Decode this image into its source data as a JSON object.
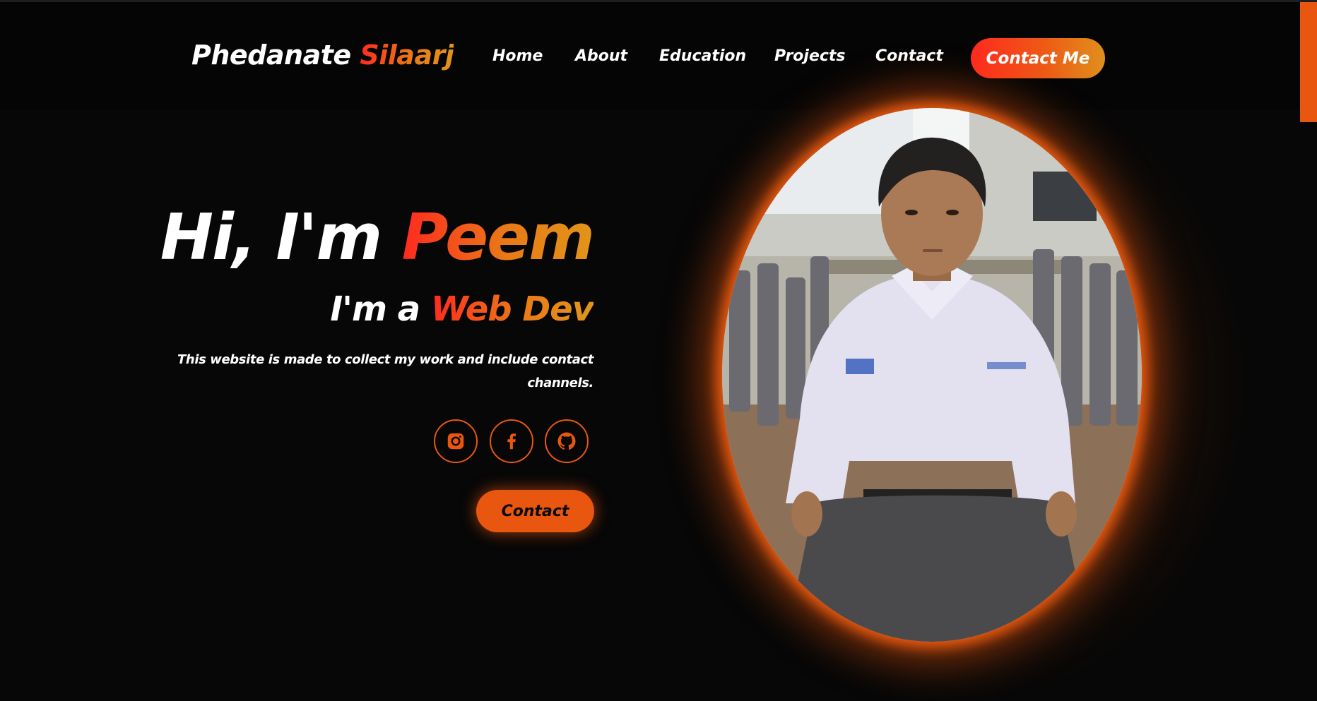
{
  "brand": {
    "first": "Phedanate",
    "last": "Silaarj"
  },
  "nav": {
    "items": [
      "Home",
      "About",
      "Education",
      "Projects",
      "Contact"
    ],
    "cta_label": "Contact Me"
  },
  "hero": {
    "title_prefix": "Hi, I'm ",
    "title_name": "Peem",
    "subtitle_prefix": "I'm a ",
    "subtitle_role": "Web Dev",
    "description": "This website is made to collect my work and include contact channels.",
    "contact_label": "Contact"
  },
  "social": [
    {
      "icon": "instagram-icon"
    },
    {
      "icon": "facebook-icon"
    },
    {
      "icon": "github-icon"
    }
  ],
  "colors": {
    "background": "#070707",
    "accent": "#e8560f",
    "gradient_start": "#ff2a1f",
    "gradient_end": "#e1951a",
    "text": "#ffffff"
  }
}
